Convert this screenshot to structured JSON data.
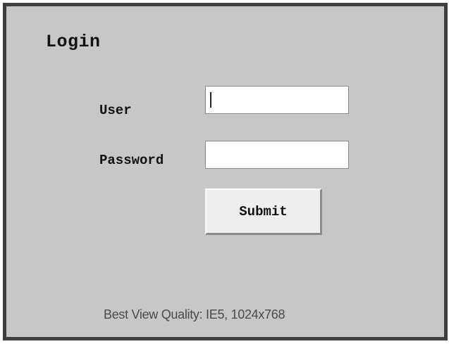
{
  "login": {
    "title": "Login",
    "user_label": "User",
    "user_value": "",
    "password_label": "Password",
    "password_value": "",
    "submit_label": "Submit"
  },
  "footer": {
    "text": "Best View Quality: IE5, 1024x768"
  }
}
